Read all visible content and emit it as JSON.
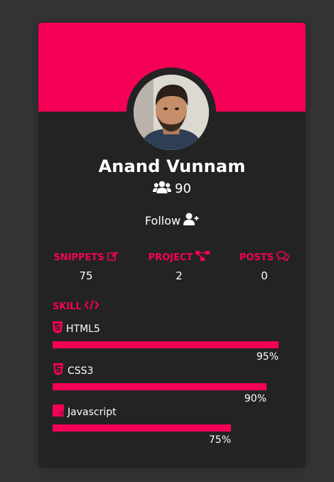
{
  "profile": {
    "name": "Anand Vunnam",
    "followers": "90",
    "follow_label": "Follow"
  },
  "stats": [
    {
      "label": "SNIPPETS",
      "value": "75",
      "icon": "edit-icon"
    },
    {
      "label": "PROJECT",
      "value": "2",
      "icon": "project-diagram-icon"
    },
    {
      "label": "POSTS",
      "value": "0",
      "icon": "comments-icon"
    }
  ],
  "skills_section": {
    "title": "SKILL",
    "icon": "code-icon",
    "items": [
      {
        "name": "HTML5",
        "percent_label": "95%",
        "level": 0.95,
        "icon": "html5-icon"
      },
      {
        "name": "CSS3",
        "percent_label": "90%",
        "level": 0.9,
        "icon": "css3-icon"
      },
      {
        "name": "Javascript",
        "percent_label": "75%",
        "level": 0.75,
        "icon": "js-icon"
      }
    ]
  },
  "colors": {
    "accent": "#f50057",
    "card": "#232323",
    "page": "#333333",
    "text": "#ffffff"
  }
}
